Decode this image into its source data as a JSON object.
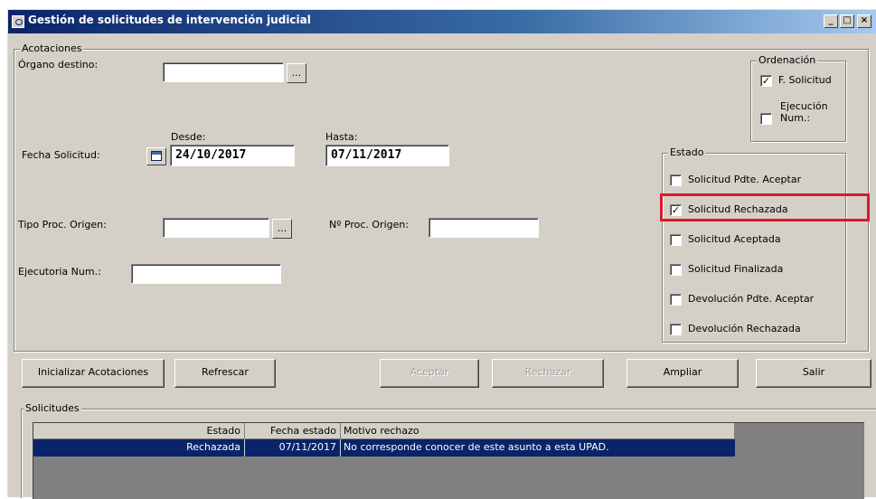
{
  "window": {
    "title": "Gestión de solicitudes de intervención judicial",
    "minimize": "_",
    "maximize": "□",
    "close": "×"
  },
  "acotaciones": {
    "legend": "Acotaciones",
    "organo_destino_label": "Órgano destino:",
    "organo_destino_value": "",
    "ellipsis": "...",
    "desde_label": "Desde:",
    "hasta_label": "Hasta:",
    "fecha_solicitud_label": "Fecha Solicitud:",
    "desde_value": "24/10/2017",
    "hasta_value": "07/11/2017",
    "tipo_proc_label": "Tipo Proc. Origen:",
    "tipo_proc_value": "",
    "num_proc_label": "Nº Proc. Origen:",
    "num_proc_value": "",
    "ejecutoria_label": "Ejecutoria Num.:",
    "ejecutoria_value": ""
  },
  "ordenacion": {
    "legend": "Ordenación",
    "items": [
      {
        "label": "F. Solicitud",
        "checked": true
      },
      {
        "label": "Ejecución Num.:",
        "checked": false
      }
    ]
  },
  "estado": {
    "legend": "Estado",
    "items": [
      {
        "label": "Solicitud Pdte. Aceptar",
        "checked": false
      },
      {
        "label": "Solicitud Rechazada",
        "checked": true
      },
      {
        "label": "Solicitud Aceptada",
        "checked": false
      },
      {
        "label": "Solicitud Finalizada",
        "checked": false
      },
      {
        "label": "Devolución Pdte. Aceptar",
        "checked": false
      },
      {
        "label": "Devolución Rechazada",
        "checked": false
      }
    ],
    "highlight_color": "#d91a2a"
  },
  "buttons": {
    "inicializar": "Inicializar Acotaciones",
    "refrescar": "Refrescar",
    "aceptar": "Aceptar",
    "rechazar": "Rechazar",
    "ampliar": "Ampliar",
    "salir": "Salir"
  },
  "solicitudes": {
    "legend": "Solicitudes",
    "columns": [
      "Estado",
      "Fecha estado",
      "Motivo rechazo"
    ],
    "rows": [
      [
        "Rechazada",
        "07/11/2017",
        "No corresponde conocer de este asunto a esta UPAD."
      ]
    ]
  },
  "colors": {
    "titlebar": "#0a246a",
    "face": "#d4d0c8",
    "selection": "#0a246a"
  }
}
